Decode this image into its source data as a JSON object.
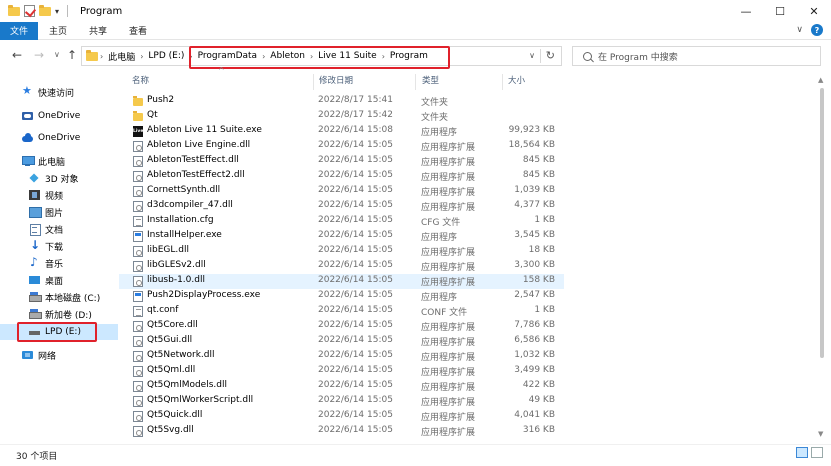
{
  "titlebar": {
    "title": "Program",
    "dropdown_glyph": "▾",
    "controls": {
      "minimize": "—",
      "maximize": "☐",
      "close": "✕"
    }
  },
  "ribbon": {
    "tabs": [
      {
        "label": "文件",
        "active": true
      },
      {
        "label": "主页",
        "active": false
      },
      {
        "label": "共享",
        "active": false
      },
      {
        "label": "查看",
        "active": false
      }
    ],
    "expand_glyph": "∨",
    "help_glyph": "?"
  },
  "nav": {
    "back": "←",
    "forward": "→",
    "recent": "∨",
    "up": "↑"
  },
  "address": {
    "crumbs": [
      "此电脑",
      "LPD (E:)",
      "ProgramData",
      "Ableton",
      "Live 11 Suite",
      "Program"
    ],
    "separator": "›",
    "dropdown": "∨",
    "refresh": "↻"
  },
  "search": {
    "placeholder": "在 Program 中搜索"
  },
  "sidebar": {
    "items": [
      {
        "label": "快速访问",
        "icon": "star-icon"
      },
      {
        "label": "OneDrive",
        "icon": "onedrive-personal-icon"
      },
      {
        "label": "OneDrive",
        "icon": "onedrive-icon"
      },
      {
        "label": "此电脑",
        "icon": "pc-icon"
      },
      {
        "label": "3D 对象",
        "icon": "3d-objects-icon"
      },
      {
        "label": "视频",
        "icon": "videos-icon"
      },
      {
        "label": "图片",
        "icon": "pictures-icon"
      },
      {
        "label": "文档",
        "icon": "documents-icon"
      },
      {
        "label": "下载",
        "icon": "downloads-icon"
      },
      {
        "label": "音乐",
        "icon": "music-icon"
      },
      {
        "label": "桌面",
        "icon": "desktop-icon"
      },
      {
        "label": "本地磁盘 (C:)",
        "icon": "drive-icon"
      },
      {
        "label": "新加卷 (D:)",
        "icon": "drive-icon"
      },
      {
        "label": "LPD (E:)",
        "icon": "usb-drive-icon",
        "selected": true
      },
      {
        "label": "网络",
        "icon": "network-icon"
      }
    ]
  },
  "columns": {
    "name": "名称",
    "date": "修改日期",
    "type": "类型",
    "size": "大小",
    "sort_glyph": "^"
  },
  "files": [
    {
      "name": "Push2",
      "date": "2022/8/17 15:41",
      "type": "文件夹",
      "size": "",
      "icon": "folder-icon"
    },
    {
      "name": "Qt",
      "date": "2022/8/17 15:42",
      "type": "文件夹",
      "size": "",
      "icon": "folder-icon"
    },
    {
      "name": "Ableton Live 11 Suite.exe",
      "date": "2022/6/14 15:08",
      "type": "应用程序",
      "size": "99,923 KB",
      "icon": "live-app-icon"
    },
    {
      "name": "Ableton Live Engine.dll",
      "date": "2022/6/14 15:05",
      "type": "应用程序扩展",
      "size": "18,564 KB",
      "icon": "dll-icon"
    },
    {
      "name": "AbletonTestEffect.dll",
      "date": "2022/6/14 15:05",
      "type": "应用程序扩展",
      "size": "845 KB",
      "icon": "dll-icon"
    },
    {
      "name": "AbletonTestEffect2.dll",
      "date": "2022/6/14 15:05",
      "type": "应用程序扩展",
      "size": "845 KB",
      "icon": "dll-icon"
    },
    {
      "name": "CornettSynth.dll",
      "date": "2022/6/14 15:05",
      "type": "应用程序扩展",
      "size": "1,039 KB",
      "icon": "dll-icon"
    },
    {
      "name": "d3dcompiler_47.dll",
      "date": "2022/6/14 15:05",
      "type": "应用程序扩展",
      "size": "4,377 KB",
      "icon": "dll-icon"
    },
    {
      "name": "Installation.cfg",
      "date": "2022/6/14 15:05",
      "type": "CFG 文件",
      "size": "1 KB",
      "icon": "cfg-icon"
    },
    {
      "name": "InstallHelper.exe",
      "date": "2022/6/14 15:05",
      "type": "应用程序",
      "size": "3,545 KB",
      "icon": "exe-icon"
    },
    {
      "name": "libEGL.dll",
      "date": "2022/6/14 15:05",
      "type": "应用程序扩展",
      "size": "18 KB",
      "icon": "dll-icon"
    },
    {
      "name": "libGLESv2.dll",
      "date": "2022/6/14 15:05",
      "type": "应用程序扩展",
      "size": "3,300 KB",
      "icon": "dll-icon"
    },
    {
      "name": "libusb-1.0.dll",
      "date": "2022/6/14 15:05",
      "type": "应用程序扩展",
      "size": "158 KB",
      "icon": "dll-icon",
      "hover": true
    },
    {
      "name": "Push2DisplayProcess.exe",
      "date": "2022/6/14 15:05",
      "type": "应用程序",
      "size": "2,547 KB",
      "icon": "exe-icon"
    },
    {
      "name": "qt.conf",
      "date": "2022/6/14 15:05",
      "type": "CONF 文件",
      "size": "1 KB",
      "icon": "cfg-icon"
    },
    {
      "name": "Qt5Core.dll",
      "date": "2022/6/14 15:05",
      "type": "应用程序扩展",
      "size": "7,786 KB",
      "icon": "dll-icon"
    },
    {
      "name": "Qt5Gui.dll",
      "date": "2022/6/14 15:05",
      "type": "应用程序扩展",
      "size": "6,586 KB",
      "icon": "dll-icon"
    },
    {
      "name": "Qt5Network.dll",
      "date": "2022/6/14 15:05",
      "type": "应用程序扩展",
      "size": "1,032 KB",
      "icon": "dll-icon"
    },
    {
      "name": "Qt5Qml.dll",
      "date": "2022/6/14 15:05",
      "type": "应用程序扩展",
      "size": "3,499 KB",
      "icon": "dll-icon"
    },
    {
      "name": "Qt5QmlModels.dll",
      "date": "2022/6/14 15:05",
      "type": "应用程序扩展",
      "size": "422 KB",
      "icon": "dll-icon"
    },
    {
      "name": "Qt5QmlWorkerScript.dll",
      "date": "2022/6/14 15:05",
      "type": "应用程序扩展",
      "size": "49 KB",
      "icon": "dll-icon"
    },
    {
      "name": "Qt5Quick.dll",
      "date": "2022/6/14 15:05",
      "type": "应用程序扩展",
      "size": "4,041 KB",
      "icon": "dll-icon"
    },
    {
      "name": "Qt5Svg.dll",
      "date": "2022/6/14 15:05",
      "type": "应用程序扩展",
      "size": "316 KB",
      "icon": "dll-icon"
    }
  ],
  "status": {
    "count": "30 个项目"
  },
  "colors": {
    "accent": "#1979ca",
    "highlight_box": "#e0212b",
    "selection": "#cce8ff",
    "hover": "#e5f3ff"
  }
}
